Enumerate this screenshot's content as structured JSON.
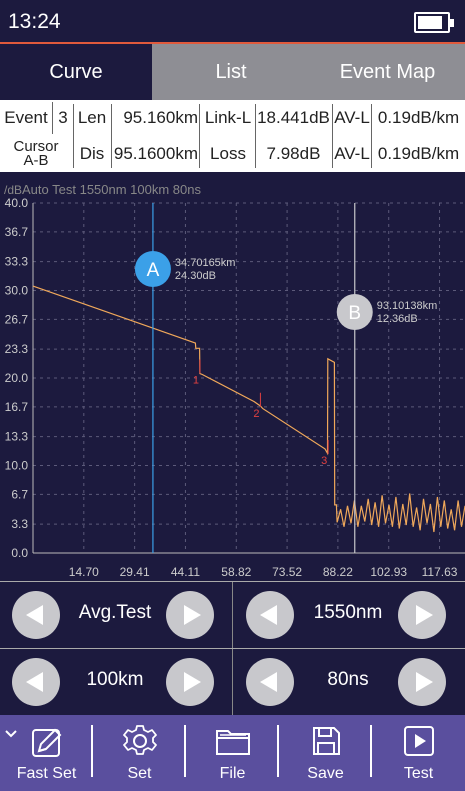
{
  "status": {
    "time": "13:24"
  },
  "tabs": [
    {
      "label": "Curve",
      "active": true
    },
    {
      "label": "List",
      "active": false
    },
    {
      "label": "Event Map",
      "active": false
    }
  ],
  "info": {
    "row1": {
      "c1": "Event",
      "c2": "3",
      "c3": "Len",
      "c4": "95.160km",
      "c5": "Link-L",
      "c6": "18.441dB",
      "c7": "AV-L",
      "c8": "0.19dB/km"
    },
    "row2": {
      "c1a": "Cursor",
      "c1b": "A-B",
      "c3": "Dis",
      "c4": "95.1600km",
      "c5": "Loss",
      "c6": "7.98dB",
      "c7": "AV-L",
      "c8": "0.19dB/km"
    }
  },
  "chart_header": {
    "unit": "/dB",
    "text": "Auto Test   1550nm  100km  80ns"
  },
  "chart_data": {
    "type": "line",
    "ylim": [
      0.0,
      40.0
    ],
    "y_ticks": [
      "40.0",
      "36.7",
      "33.3",
      "30.0",
      "26.7",
      "23.3",
      "20.0",
      "16.7",
      "13.3",
      "10.0",
      "6.7",
      "3.3",
      "0.0"
    ],
    "x_ticks": [
      "14.70",
      "29.41",
      "44.11",
      "58.82",
      "73.52",
      "88.22",
      "102.93",
      "117.63"
    ],
    "xlim": [
      0.0,
      125.0
    ],
    "grid": true,
    "trace": [
      [
        0,
        30.5
      ],
      [
        47,
        24.0
      ],
      [
        47.1,
        23.4
      ],
      [
        48.2,
        23.4
      ],
      [
        48.3,
        20.5
      ],
      [
        49,
        20.4
      ],
      [
        64,
        17.3
      ],
      [
        65.8,
        16.8
      ],
      [
        66.5,
        16.5
      ],
      [
        84.5,
        11.9
      ],
      [
        85.2,
        11.4
      ],
      [
        85.3,
        22.2
      ],
      [
        87.2,
        21.8
      ],
      [
        87.3,
        5.5
      ],
      [
        87.8,
        5.5
      ],
      [
        88,
        3.5
      ],
      [
        89,
        5.0
      ],
      [
        90,
        3.0
      ],
      [
        91,
        5.4
      ],
      [
        92,
        3.4
      ],
      [
        93,
        6.0
      ],
      [
        94,
        3.0
      ],
      [
        95,
        5.4
      ],
      [
        96,
        3.6
      ],
      [
        97,
        6.2
      ],
      [
        98,
        3.2
      ],
      [
        99,
        5.8
      ],
      [
        100,
        3.0
      ],
      [
        101,
        6.6
      ],
      [
        102,
        3.4
      ],
      [
        103,
        5.5
      ],
      [
        104,
        3.0
      ],
      [
        105,
        6.4
      ],
      [
        106,
        2.8
      ],
      [
        107,
        5.6
      ],
      [
        108,
        3.2
      ],
      [
        109,
        6.8
      ],
      [
        110,
        3.0
      ],
      [
        111,
        5.2
      ],
      [
        112,
        2.6
      ],
      [
        113,
        6.2
      ],
      [
        114,
        3.4
      ],
      [
        115,
        5.6
      ],
      [
        116,
        2.4
      ],
      [
        117,
        6.4
      ],
      [
        118,
        3.0
      ],
      [
        119,
        6.0
      ],
      [
        120,
        2.8
      ],
      [
        121,
        5.0
      ],
      [
        122,
        2.6
      ],
      [
        123,
        6.0
      ],
      [
        124,
        3.0
      ],
      [
        125,
        5.4
      ]
    ],
    "events": [
      {
        "label": "1",
        "x": 48.3,
        "y": 19.6
      },
      {
        "label": "2",
        "x": 65.8,
        "y": 15.8
      },
      {
        "label": "3",
        "x": 85.4,
        "y": 10.4
      }
    ],
    "cursors": [
      {
        "name": "A",
        "x": 34.70165,
        "distance": "34.70165km",
        "level": "24.30dB",
        "color": "#3ba0e8"
      },
      {
        "name": "B",
        "x": 93.10138,
        "distance": "93.10138km",
        "level": "12.36dB",
        "color": "#c8c8cc"
      }
    ],
    "trace_color": "#f0a85a",
    "event_color": "#e04040"
  },
  "controls": {
    "row1_left": "Avg.Test",
    "row1_right": "1550nm",
    "row2_left": "100km",
    "row2_right": "80ns"
  },
  "toolbar": [
    {
      "label": "Fast Set",
      "icon": "fast-set-icon"
    },
    {
      "label": "Set",
      "icon": "gear-icon"
    },
    {
      "label": "File",
      "icon": "folder-icon"
    },
    {
      "label": "Save",
      "icon": "floppy-icon"
    },
    {
      "label": "Test",
      "icon": "play-icon"
    }
  ],
  "colors": {
    "background": "#1c1a3e",
    "accent": "#e05a3c",
    "toolbar": "#5a4f9e"
  }
}
